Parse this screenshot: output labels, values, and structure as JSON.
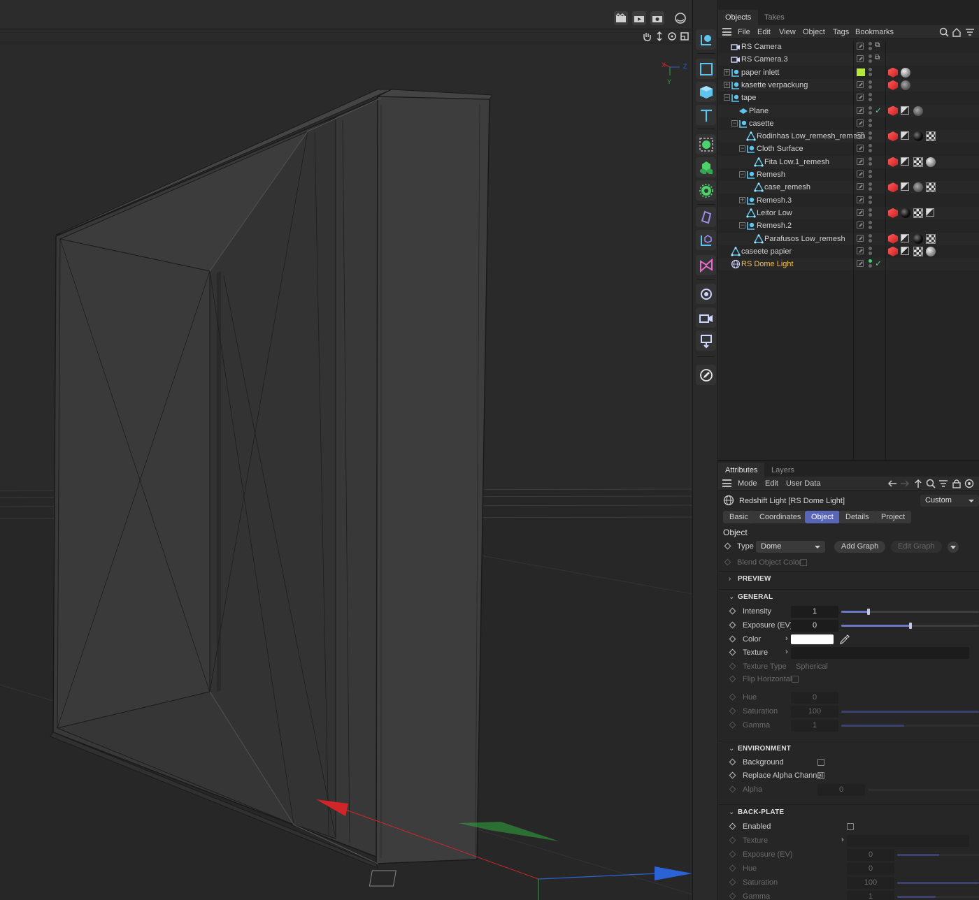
{
  "objects_panel": {
    "tabs": [
      "Objects",
      "Takes"
    ],
    "menu": [
      "File",
      "Edit",
      "View",
      "Object",
      "Tags",
      "Bookmarks"
    ],
    "items": [
      {
        "name": "RS Camera",
        "indent": 0,
        "icon": "camera-icon",
        "expand": "",
        "tags": []
      },
      {
        "name": "RS Camera.3",
        "indent": 0,
        "icon": "camera-icon",
        "expand": "",
        "tags": []
      },
      {
        "name": "paper inlett",
        "indent": 0,
        "icon": "null-icon",
        "expand": "+",
        "layer_color": "#b4e83a",
        "tags": [
          "red",
          "sph"
        ]
      },
      {
        "name": "kasette verpackung",
        "indent": 0,
        "icon": "null-icon",
        "expand": "+",
        "tags": [
          "red",
          "tex"
        ]
      },
      {
        "name": "tape",
        "indent": 0,
        "icon": "null-icon",
        "expand": "−",
        "tags": []
      },
      {
        "name": "Plane",
        "indent": 1,
        "icon": "plane-icon",
        "expand": "",
        "tags": [
          "red",
          "flag",
          "tex"
        ],
        "check": true
      },
      {
        "name": "casette",
        "indent": 1,
        "icon": "null-icon",
        "expand": "−",
        "tags": []
      },
      {
        "name": "Rodinhas Low_remesh_remesh",
        "indent": 2,
        "icon": "polygon-icon",
        "expand": "",
        "tags": [
          "red",
          "flag",
          "blk",
          "chk"
        ]
      },
      {
        "name": "Cloth Surface",
        "indent": 2,
        "icon": "null-icon",
        "expand": "−",
        "tags": []
      },
      {
        "name": "Fita Low.1_remesh",
        "indent": 3,
        "icon": "polygon-icon",
        "expand": "",
        "tags": [
          "red",
          "flag",
          "chk",
          "sph"
        ]
      },
      {
        "name": "Remesh",
        "indent": 2,
        "icon": "null-icon",
        "expand": "−",
        "tags": []
      },
      {
        "name": "case_remesh",
        "indent": 3,
        "icon": "polygon-icon",
        "expand": "",
        "tags": [
          "red",
          "flag",
          "tex",
          "chk"
        ]
      },
      {
        "name": "Remesh.3",
        "indent": 2,
        "icon": "null-icon",
        "expand": "+",
        "tags": []
      },
      {
        "name": "Leitor Low",
        "indent": 2,
        "icon": "polygon-icon",
        "expand": "",
        "tags": [
          "red",
          "blk",
          "chk",
          "flag"
        ]
      },
      {
        "name": "Remesh.2",
        "indent": 2,
        "icon": "null-icon",
        "expand": "−",
        "tags": []
      },
      {
        "name": "Parafusos Low_remesh",
        "indent": 3,
        "icon": "polygon-icon",
        "expand": "",
        "tags": [
          "red",
          "flag",
          "blk",
          "chk"
        ]
      },
      {
        "name": "caseete papier",
        "indent": 0,
        "icon": "polygon-icon",
        "expand": "",
        "tags": [
          "red",
          "flag",
          "chk",
          "sph"
        ]
      },
      {
        "name": "RS Dome Light",
        "indent": 0,
        "icon": "dome-icon",
        "expand": "",
        "tags": [],
        "check": true,
        "selected": true
      }
    ]
  },
  "attributes": {
    "tabs": [
      "Attributes",
      "Layers"
    ],
    "menu": [
      "Mode",
      "Edit",
      "User Data"
    ],
    "object_title": "Redshift Light [RS Dome Light]",
    "preset": "Custom",
    "subtabs": [
      "Basic",
      "Coordinates",
      "Object",
      "Details",
      "Project"
    ],
    "active_subtab": "Object",
    "section_title": "Object",
    "type_label": "Type",
    "type_value": "Dome",
    "add_graph": "Add Graph",
    "edit_graph": "Edit Graph",
    "blend_object_color": "Blend Object Color",
    "sections": {
      "preview": "PREVIEW",
      "general": "GENERAL",
      "environment": "ENVIRONMENT",
      "backplate": "BACK-PLATE"
    },
    "general": {
      "intensity_label": "Intensity",
      "intensity": "1",
      "intensity_level": 0.2,
      "exposure_label": "Exposure (EV)",
      "exposure": "0",
      "exposure_level": 0.5,
      "color_label": "Color",
      "color": "#ffffff",
      "texture_label": "Texture",
      "texture_type_label": "Texture Type",
      "texture_type": "Spherical",
      "flip_label": "Flip Horizontal",
      "hue_label": "Hue",
      "hue": "0",
      "saturation_label": "Saturation",
      "saturation": "100",
      "gamma_label": "Gamma",
      "gamma": "1"
    },
    "environment": {
      "background_label": "Background",
      "replace_alpha_label": "Replace Alpha Channel",
      "alpha_label": "Alpha",
      "alpha": "0"
    },
    "backplate": {
      "enabled_label": "Enabled",
      "texture_label": "Texture",
      "exposure_label": "Exposure (EV)",
      "exposure": "0",
      "hue_label": "Hue",
      "hue": "0",
      "saturation_label": "Saturation",
      "saturation": "100",
      "gamma_label": "Gamma",
      "gamma": "1"
    }
  },
  "viewport": {
    "axis_x": "X",
    "axis_y": "Y",
    "axis_z": "Z",
    "gizmo_colors": {
      "x": "#d0262a",
      "y": "#2ea23a",
      "z": "#2b63d6"
    }
  },
  "toolbar": [
    "null-icon",
    "rectangle-icon",
    "cube-icon",
    "text-icon",
    "cloner-icon",
    "mograph-icon",
    "gear-light-icon",
    "deformer-icon",
    "field-icon",
    "spline-tool-icon",
    "sphere-light-icon",
    "camera-icon",
    "light-icon",
    "edit-icon"
  ]
}
